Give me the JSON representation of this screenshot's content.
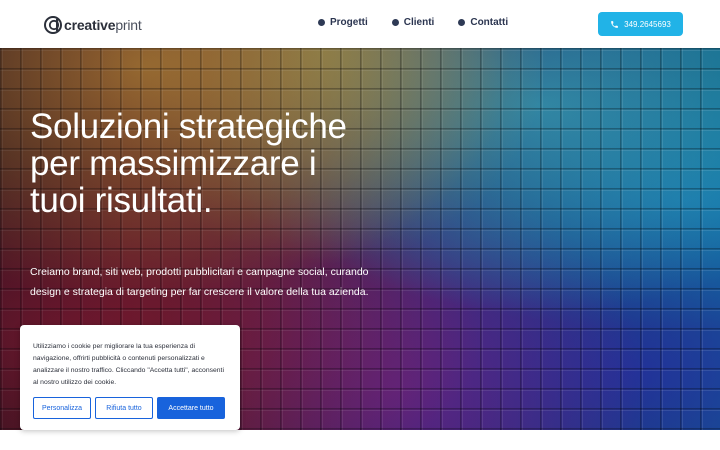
{
  "header": {
    "logo": {
      "bold": "creative",
      "light": "print"
    },
    "nav": [
      {
        "label": "Progetti"
      },
      {
        "label": "Clienti"
      },
      {
        "label": "Contatti"
      }
    ],
    "phone": {
      "label": "349.2645693",
      "icon": "phone-icon"
    }
  },
  "hero": {
    "title": "Soluzioni strategiche per massimizzare i tuoi risultati.",
    "subtitle": "Creiamo brand, siti web, prodotti pubblicitari e campagne social, curando design e strategia di targeting per far crescere il valore della tua azienda."
  },
  "cookie_banner": {
    "text": "Utilizziamo i cookie per migliorare la tua esperienza di navigazione, offrirti pubblicità o contenuti personalizzati e analizzare il nostro traffico. Cliccando \"Accetta tutti\", acconsenti al nostro utilizzo dei cookie.",
    "buttons": {
      "customize": "Personalizza",
      "reject": "Rifiuta tutto",
      "accept": "Accettare tutto"
    }
  },
  "colors": {
    "accent": "#21b3e7",
    "cookie_primary": "#1863dc",
    "nav_text": "#2b3550"
  }
}
